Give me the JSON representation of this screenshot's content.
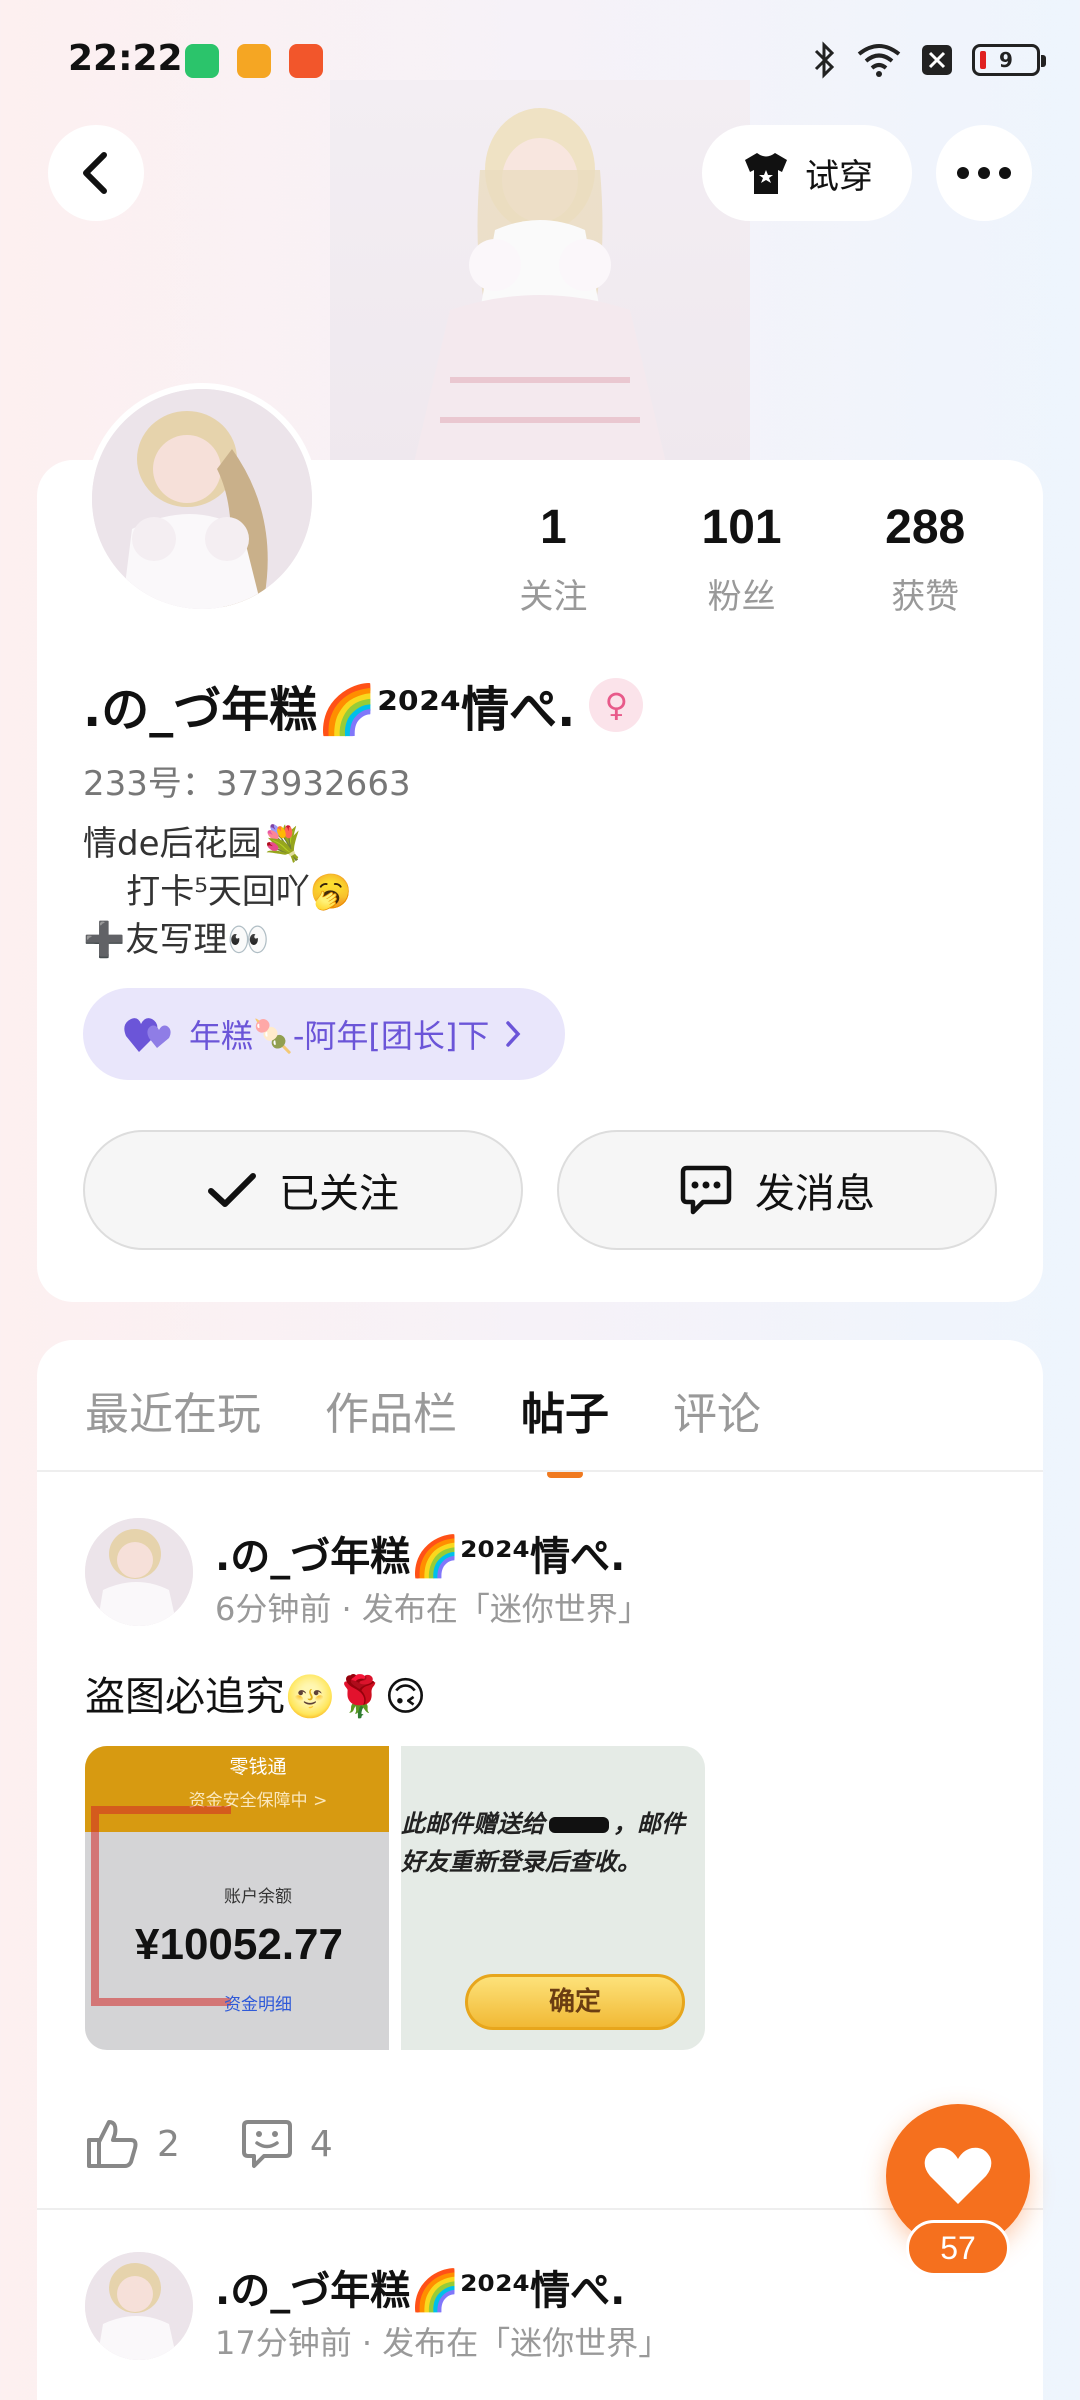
{
  "status_bar": {
    "time": "22:22",
    "battery_level": "9",
    "icons": [
      "bluetooth-icon",
      "wifi-icon",
      "sim-off-icon",
      "battery-icon"
    ]
  },
  "header": {
    "back_icon": "chevron-left-icon",
    "try_on_label": "试穿",
    "more_icon": "more-dots-icon"
  },
  "profile": {
    "stats": [
      {
        "value": "1",
        "label": "关注"
      },
      {
        "value": "101",
        "label": "粉丝"
      },
      {
        "value": "288",
        "label": "获赞"
      }
    ],
    "name": ".の_づ年糕🌈²⁰²⁴情ぺ.",
    "gender_symbol": "♀",
    "uid": "233号：373932663",
    "bio": "情de后花园💐\n    打卡⁵天回吖🥱\n➕友写理👀",
    "group": "年糕🍡-阿年[团长]下",
    "follow_label": "已关注",
    "message_label": "发消息"
  },
  "tabs": [
    {
      "label": "最近在玩",
      "active": false
    },
    {
      "label": "作品栏",
      "active": false
    },
    {
      "label": "帖子",
      "active": true
    },
    {
      "label": "评论",
      "active": false
    }
  ],
  "posts": [
    {
      "author": ".の_づ年糕🌈²⁰²⁴情ぺ.",
      "meta": "6分钟前 · 发布在「迷你世界」",
      "text": "盗图必追究🌝🌹🙃",
      "image1": {
        "header": "零钱通",
        "sub": "资金安全保障中 >",
        "balance_label": "账户余额",
        "balance": "¥10052.77",
        "detail": "资金明细"
      },
      "image2": {
        "line1": "此邮件赠送给",
        "line1b": "，邮件",
        "line2": "好友重新登录后查收。",
        "button": "确定"
      },
      "likes": "2",
      "comments": "4"
    },
    {
      "author": ".の_づ年糕🌈²⁰²⁴情ぺ.",
      "meta": "17分钟前 · 发布在「迷你世界」"
    }
  ],
  "fab": {
    "count": "57"
  }
}
